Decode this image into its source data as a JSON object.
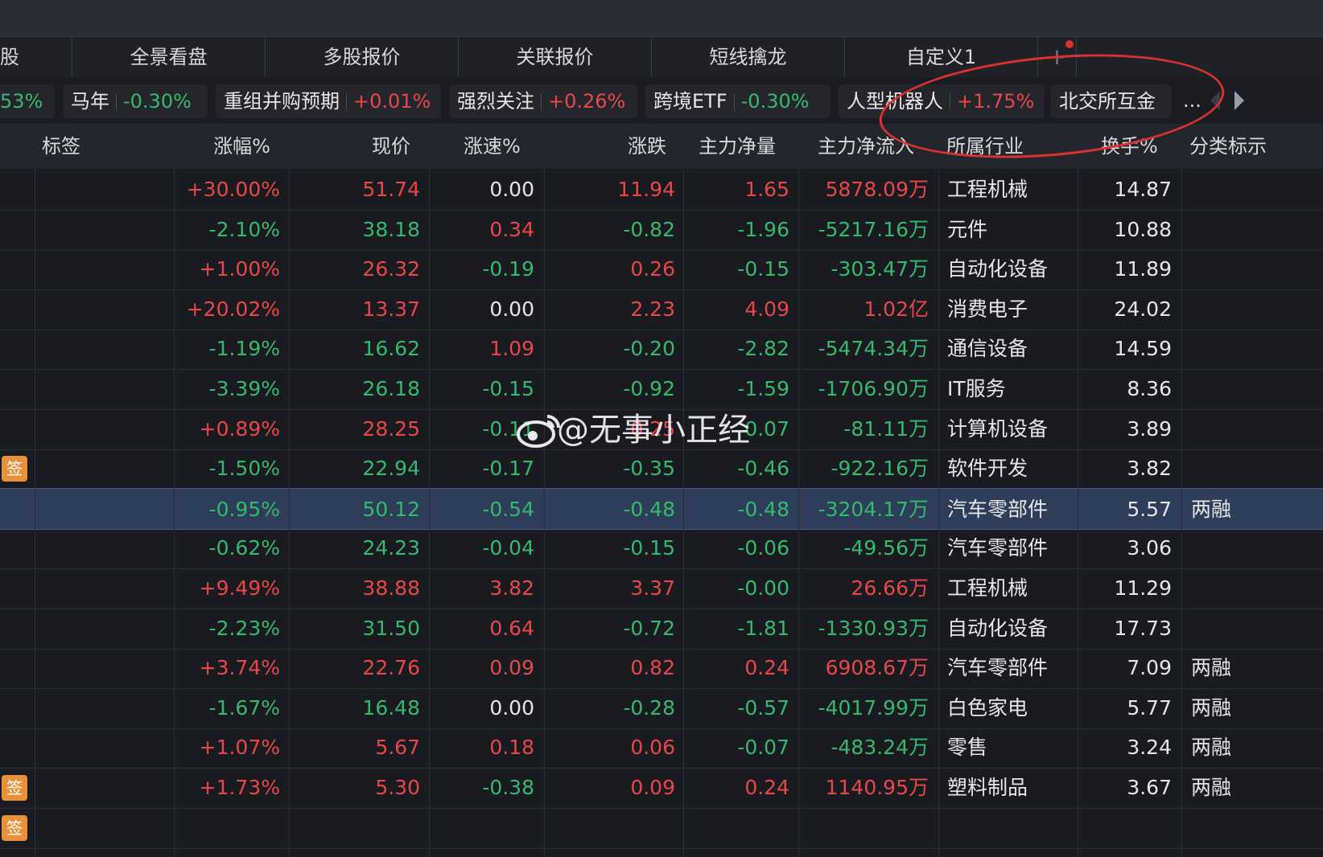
{
  "tabs": [
    {
      "label": "股"
    },
    {
      "label": "全景看盘"
    },
    {
      "label": "多股报价"
    },
    {
      "label": "关联报价"
    },
    {
      "label": "短线擒龙"
    },
    {
      "label": "自定义1"
    },
    {
      "label": "+"
    }
  ],
  "chips": [
    {
      "name": "",
      "change": "53%",
      "dir": "down"
    },
    {
      "name": "马年",
      "change": "-0.30%",
      "dir": "down"
    },
    {
      "name": "重组并购预期",
      "change": "+0.01%",
      "dir": "up"
    },
    {
      "name": "强烈关注",
      "change": "+0.26%",
      "dir": "up"
    },
    {
      "name": "跨境ETF",
      "change": "-0.30%",
      "dir": "down"
    },
    {
      "name": "人型机器人",
      "change": "+1.75%",
      "dir": "up"
    },
    {
      "name": "北交所互金",
      "change": "",
      "dir": "up"
    }
  ],
  "more_label": "...",
  "headers": {
    "tag": "标签",
    "pct": "涨幅%",
    "price": "现价",
    "speed": "涨速%",
    "change": "涨跌",
    "main_vol": "主力净量",
    "main_flow": "主力净流入",
    "industry": "所属行业",
    "turnover": "换手%",
    "category": "分类标示"
  },
  "rows": [
    {
      "badge": "",
      "pct": "+30.00%",
      "price": "51.74",
      "speed": "0.00",
      "change": "11.94",
      "main_vol": "1.65",
      "main_flow": "5878.09万",
      "industry": "工程机械",
      "turnover": "14.87",
      "category": "",
      "c": [
        "up",
        "up",
        "neu",
        "up",
        "up",
        "up"
      ]
    },
    {
      "badge": "",
      "pct": "-2.10%",
      "price": "38.18",
      "speed": "0.34",
      "change": "-0.82",
      "main_vol": "-1.96",
      "main_flow": "-5217.16万",
      "industry": "元件",
      "turnover": "10.88",
      "category": "",
      "c": [
        "down",
        "down",
        "up",
        "down",
        "down",
        "down"
      ]
    },
    {
      "badge": "",
      "pct": "+1.00%",
      "price": "26.32",
      "speed": "-0.19",
      "change": "0.26",
      "main_vol": "-0.15",
      "main_flow": "-303.47万",
      "industry": "自动化设备",
      "turnover": "11.89",
      "category": "",
      "c": [
        "up",
        "up",
        "down",
        "up",
        "down",
        "down"
      ]
    },
    {
      "badge": "",
      "pct": "+20.02%",
      "price": "13.37",
      "speed": "0.00",
      "change": "2.23",
      "main_vol": "4.09",
      "main_flow": "1.02亿",
      "industry": "消费电子",
      "turnover": "24.02",
      "category": "",
      "c": [
        "up",
        "up",
        "neu",
        "up",
        "up",
        "up"
      ]
    },
    {
      "badge": "",
      "pct": "-1.19%",
      "price": "16.62",
      "speed": "1.09",
      "change": "-0.20",
      "main_vol": "-2.82",
      "main_flow": "-5474.34万",
      "industry": "通信设备",
      "turnover": "14.59",
      "category": "",
      "c": [
        "down",
        "down",
        "up",
        "down",
        "down",
        "down"
      ]
    },
    {
      "badge": "",
      "pct": "-3.39%",
      "price": "26.18",
      "speed": "-0.15",
      "change": "-0.92",
      "main_vol": "-1.59",
      "main_flow": "-1706.90万",
      "industry": "IT服务",
      "turnover": "8.36",
      "category": "",
      "c": [
        "down",
        "down",
        "down",
        "down",
        "down",
        "down"
      ]
    },
    {
      "badge": "",
      "pct": "+0.89%",
      "price": "28.25",
      "speed": "-0.11",
      "change": "0.25",
      "main_vol": "0.07",
      "main_flow": "-81.11万",
      "industry": "计算机设备",
      "turnover": "3.89",
      "category": "",
      "c": [
        "up",
        "up",
        "down",
        "up",
        "down",
        "down"
      ]
    },
    {
      "badge": "签",
      "pct": "-1.50%",
      "price": "22.94",
      "speed": "-0.17",
      "change": "-0.35",
      "main_vol": "-0.46",
      "main_flow": "-922.16万",
      "industry": "软件开发",
      "turnover": "3.82",
      "category": "",
      "c": [
        "down",
        "down",
        "down",
        "down",
        "down",
        "down"
      ]
    },
    {
      "badge": "",
      "pct": "-0.95%",
      "price": "50.12",
      "speed": "-0.54",
      "change": "-0.48",
      "main_vol": "-0.48",
      "main_flow": "-3204.17万",
      "industry": "汽车零部件",
      "turnover": "5.57",
      "category": "两融",
      "c": [
        "down",
        "down",
        "down",
        "down",
        "down",
        "down"
      ],
      "selected": true
    },
    {
      "badge": "",
      "pct": "-0.62%",
      "price": "24.23",
      "speed": "-0.04",
      "change": "-0.15",
      "main_vol": "-0.06",
      "main_flow": "-49.56万",
      "industry": "汽车零部件",
      "turnover": "3.06",
      "category": "",
      "c": [
        "down",
        "down",
        "down",
        "down",
        "down",
        "down"
      ]
    },
    {
      "badge": "",
      "pct": "+9.49%",
      "price": "38.88",
      "speed": "3.82",
      "change": "3.37",
      "main_vol": "-0.00",
      "main_flow": "26.66万",
      "industry": "工程机械",
      "turnover": "11.29",
      "category": "",
      "c": [
        "up",
        "up",
        "up",
        "up",
        "down",
        "up"
      ]
    },
    {
      "badge": "",
      "pct": "-2.23%",
      "price": "31.50",
      "speed": "0.64",
      "change": "-0.72",
      "main_vol": "-1.81",
      "main_flow": "-1330.93万",
      "industry": "自动化设备",
      "turnover": "17.73",
      "category": "",
      "c": [
        "down",
        "down",
        "up",
        "down",
        "down",
        "down"
      ]
    },
    {
      "badge": "",
      "pct": "+3.74%",
      "price": "22.76",
      "speed": "0.09",
      "change": "0.82",
      "main_vol": "0.24",
      "main_flow": "6908.67万",
      "industry": "汽车零部件",
      "turnover": "7.09",
      "category": "两融",
      "c": [
        "up",
        "up",
        "up",
        "up",
        "up",
        "up"
      ]
    },
    {
      "badge": "",
      "pct": "-1.67%",
      "price": "16.48",
      "speed": "0.00",
      "change": "-0.28",
      "main_vol": "-0.57",
      "main_flow": "-4017.99万",
      "industry": "白色家电",
      "turnover": "5.77",
      "category": "两融",
      "c": [
        "down",
        "down",
        "neu",
        "down",
        "down",
        "down"
      ]
    },
    {
      "badge": "",
      "pct": "+1.07%",
      "price": "5.67",
      "speed": "0.18",
      "change": "0.06",
      "main_vol": "-0.07",
      "main_flow": "-483.24万",
      "industry": "零售",
      "turnover": "3.24",
      "category": "两融",
      "c": [
        "up",
        "up",
        "up",
        "up",
        "down",
        "down"
      ]
    },
    {
      "badge": "签",
      "pct": "+1.73%",
      "price": "5.30",
      "speed": "-0.38",
      "change": "0.09",
      "main_vol": "0.24",
      "main_flow": "1140.95万",
      "industry": "塑料制品",
      "turnover": "3.67",
      "category": "两融",
      "c": [
        "up",
        "up",
        "down",
        "up",
        "up",
        "up"
      ]
    },
    {
      "badge": "签",
      "pct": "",
      "price": "",
      "speed": "",
      "change": "",
      "main_vol": "",
      "main_flow": "",
      "industry": "",
      "turnover": "",
      "category": "",
      "c": [
        "up",
        "up",
        "up",
        "up",
        "up",
        "up"
      ]
    }
  ],
  "watermark": "@无事小正经",
  "colors": {
    "up": "#e8474a",
    "down": "#36b86f",
    "highlight_ellipse": "#d8332e",
    "badge": "#e8903a"
  }
}
